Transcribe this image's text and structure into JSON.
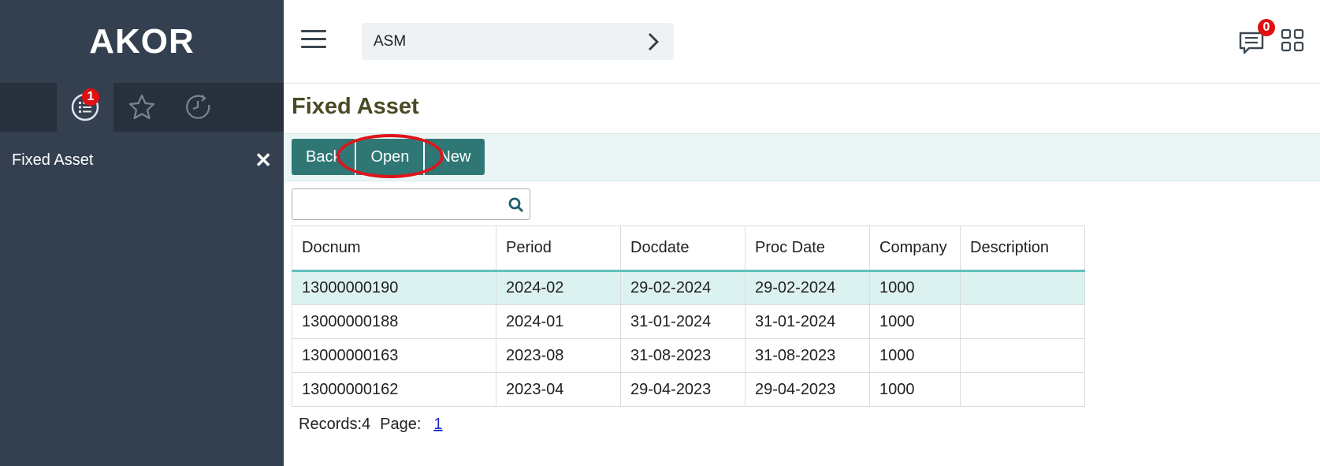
{
  "sidebar": {
    "brand": "AKOR",
    "tabs": [
      {
        "icon": "list-icon",
        "badge": "1"
      },
      {
        "icon": "star-icon"
      },
      {
        "icon": "history-icon"
      }
    ],
    "items": [
      {
        "label": "Fixed Asset",
        "close": "✕"
      }
    ]
  },
  "header": {
    "breadcrumb": "ASM",
    "messages_badge": "0"
  },
  "main": {
    "title": "Fixed Asset",
    "buttons": {
      "back": "Back",
      "open": "Open",
      "new": "New"
    },
    "search": {
      "value": "",
      "placeholder": ""
    },
    "table": {
      "columns": [
        "Docnum",
        "Period",
        "Docdate",
        "Proc Date",
        "Company",
        "Description"
      ],
      "rows": [
        [
          "13000000190",
          "2024-02",
          "29-02-2024",
          "29-02-2024",
          "1000",
          ""
        ],
        [
          "13000000188",
          "2024-01",
          "31-01-2024",
          "31-01-2024",
          "1000",
          ""
        ],
        [
          "13000000163",
          "2023-08",
          "31-08-2023",
          "31-08-2023",
          "1000",
          ""
        ],
        [
          "13000000162",
          "2023-04",
          "29-04-2023",
          "29-04-2023",
          "1000",
          ""
        ]
      ]
    },
    "pager": {
      "records": "Records:4",
      "page_label": "Page:",
      "page": "1"
    }
  },
  "colors": {
    "sidebar_bg": "#344050",
    "button": "#2e7775",
    "toolbar_bg": "#eaf6f6",
    "selected_row": "#dcf2f1",
    "annotation": "#e0141b",
    "badge": "#e01010"
  }
}
